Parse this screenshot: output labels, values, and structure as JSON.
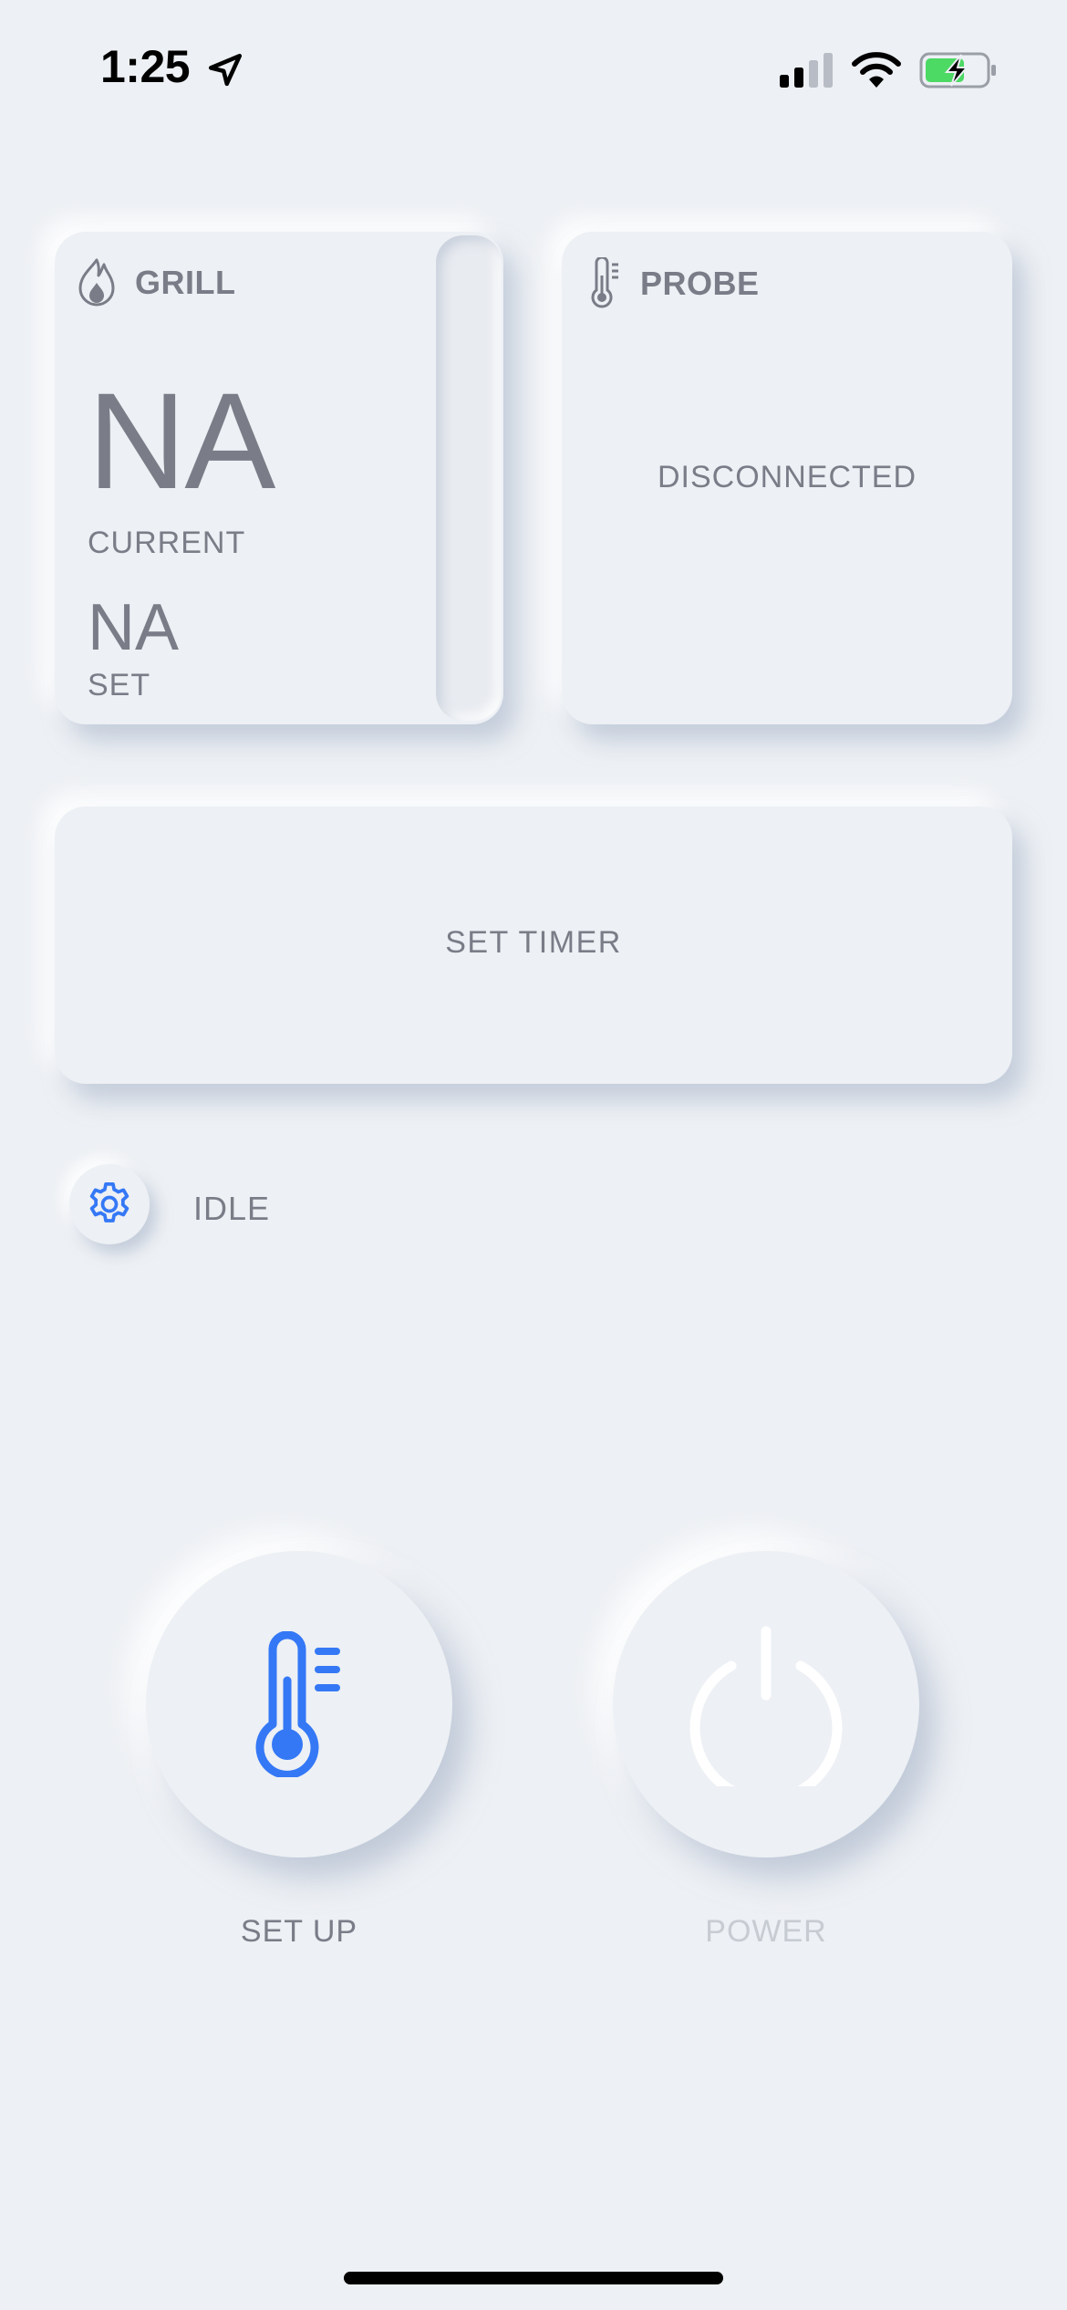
{
  "status_bar": {
    "time": "1:25",
    "icons": [
      "location-arrow-icon",
      "cellular-signal-icon",
      "wifi-icon",
      "battery-charging-icon"
    ]
  },
  "grill_card": {
    "title": "GRILL",
    "icon": "flame-icon",
    "current_value": "NA",
    "current_label": "CURRENT",
    "set_value": "NA",
    "set_label": "SET"
  },
  "probe_card": {
    "title": "PROBE",
    "icon": "thermometer-icon",
    "status": "DISCONNECTED"
  },
  "timer_card": {
    "label": "SET TIMER"
  },
  "mode": {
    "icon": "gear-icon",
    "status": "IDLE"
  },
  "actions": {
    "setup_label": "SET UP",
    "setup_icon": "thermometer-icon",
    "power_label": "POWER",
    "power_icon": "power-icon"
  },
  "colors": {
    "background": "#edf0f4",
    "text": "#7a7c87",
    "accent": "#3478f6",
    "disabled": "#c7cbd2"
  }
}
